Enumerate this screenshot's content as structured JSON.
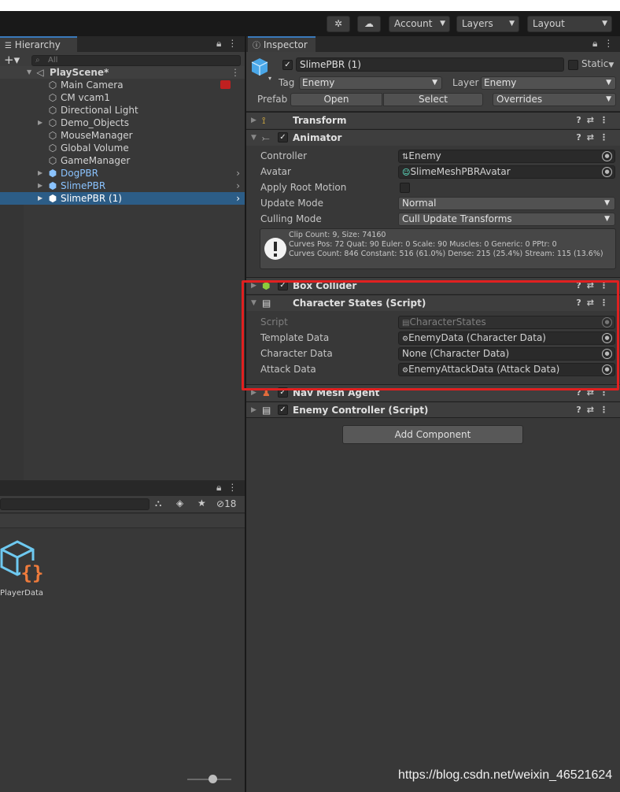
{
  "toolbar": {
    "account_label": "Account",
    "layers_label": "Layers",
    "layout_label": "Layout"
  },
  "hierarchy": {
    "tab_label": "Hierarchy",
    "search_placeholder": "All",
    "scene_name": "PlayScene*",
    "items": [
      {
        "label": "Main Camera"
      },
      {
        "label": "CM vcam1"
      },
      {
        "label": "Directional Light"
      },
      {
        "label": "Demo_Objects"
      },
      {
        "label": "MouseManager"
      },
      {
        "label": "Global Volume"
      },
      {
        "label": "GameManager"
      },
      {
        "label": "DogPBR"
      },
      {
        "label": "SlimePBR"
      },
      {
        "label": "SlimePBR (1)"
      }
    ]
  },
  "project": {
    "hidden_count": "18",
    "asset_label": "PlayerData"
  },
  "inspector": {
    "tab_label": "Inspector",
    "object_name": "SlimePBR (1)",
    "static_label": "Static",
    "tag_label": "Tag",
    "tag_value": "Enemy",
    "layer_label": "Layer",
    "layer_value": "Enemy",
    "prefab_label": "Prefab",
    "open_label": "Open",
    "select_label": "Select",
    "overrides_label": "Overrides",
    "transform_title": "Transform",
    "animator": {
      "title": "Animator",
      "controller_label": "Controller",
      "controller_value": "Enemy",
      "avatar_label": "Avatar",
      "avatar_value": "SlimeMeshPBRAvatar",
      "apply_root_label": "Apply Root Motion",
      "update_mode_label": "Update Mode",
      "update_mode_value": "Normal",
      "culling_label": "Culling Mode",
      "culling_value": "Cull Update Transforms",
      "info_line1": "Clip Count: 9, Size: 74160",
      "info_line2": "Curves Pos: 72 Quat: 90 Euler: 0 Scale: 90 Muscles: 0 Generic: 0 PPtr: 0",
      "info_line3": "Curves Count: 846 Constant: 516 (61.0%) Dense: 215 (25.4%) Stream: 115 (13.6%)"
    },
    "box_collider_title": "Box Collider",
    "character_states": {
      "title": "Character States (Script)",
      "script_label": "Script",
      "script_value": "CharacterStates",
      "template_label": "Template Data",
      "template_value": "EnemyData (Character Data)",
      "character_label": "Character Data",
      "character_value": "None (Character Data)",
      "attack_label": "Attack Data",
      "attack_value": "EnemyAttackData (Attack Data)"
    },
    "navmesh_title": "Nav Mesh Agent",
    "enemy_controller_title": "Enemy Controller (Script)",
    "add_component_label": "Add Component"
  },
  "watermark": "https://blog.csdn.net/weixin_46521624",
  "colors": {
    "highlight_box": "#e02020",
    "selection": "#2c5d87",
    "prefab_text": "#8ac3ff",
    "tab_accent": "#3a79bb"
  }
}
